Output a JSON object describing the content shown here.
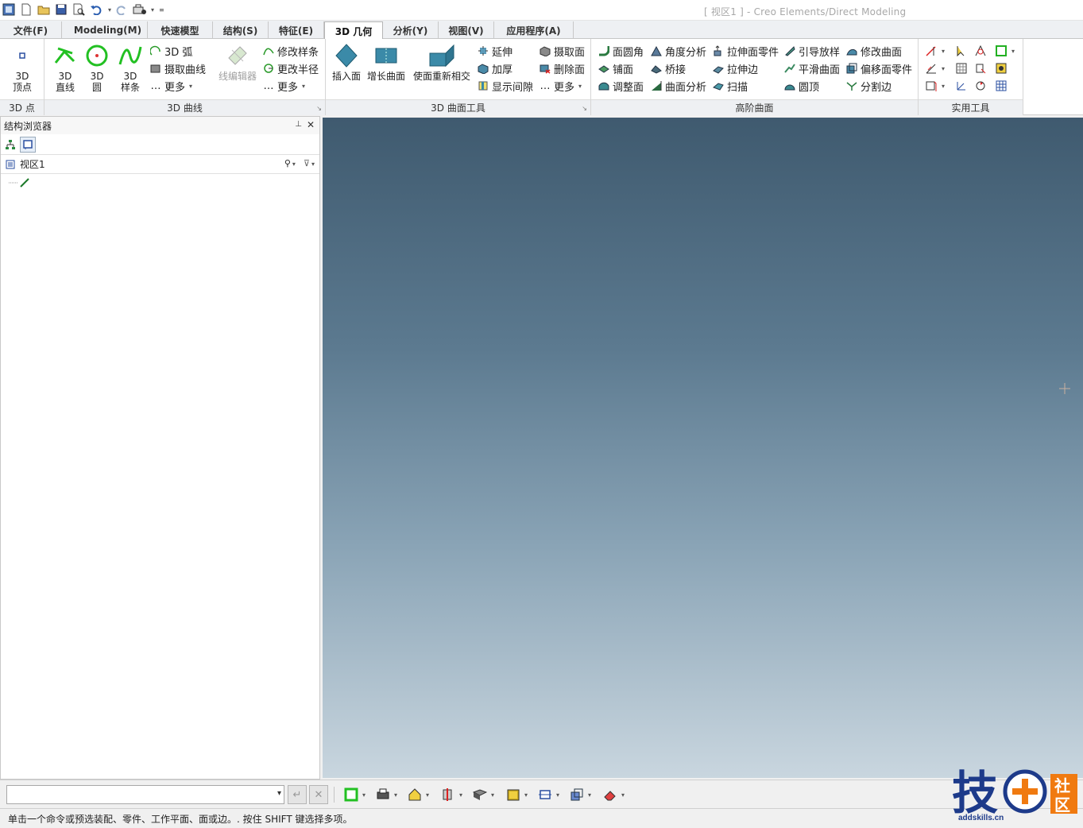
{
  "window": {
    "title": "[ 视区1 ] - Creo Elements/Direct Modeling"
  },
  "quick_access": {
    "icons": [
      "app-menu-icon",
      "new-file-icon",
      "open-folder-icon",
      "save-icon",
      "print-preview-icon",
      "undo-icon",
      "redo-icon",
      "settings-tool-icon",
      "customize-icon"
    ]
  },
  "tabs": [
    {
      "label": "文件(F)"
    },
    {
      "label": "Modeling(M)"
    },
    {
      "label": "快速模型"
    },
    {
      "label": "结构(S)"
    },
    {
      "label": "特征(E)"
    },
    {
      "label": "3D 几何",
      "active": true
    },
    {
      "label": "分析(Y)"
    },
    {
      "label": "视图(V)"
    },
    {
      "label": "应用程序(A)"
    }
  ],
  "ribbon": {
    "groups": {
      "point": {
        "label": "3D 点",
        "vertex": "3D\n顶点"
      },
      "curve": {
        "label": "3D 曲线",
        "line": "3D\n直线",
        "circle": "3D\n圆",
        "spline": "3D\n样条",
        "arc": "3D 弧",
        "extract_curve": "摄取曲线",
        "more1": "更多",
        "wire_editor": "线编辑器",
        "modify_spline": "修改样条",
        "change_radius": "更改半径",
        "more2": "更多"
      },
      "surface_tools": {
        "label": "3D 曲面工具",
        "insert_face": "插入面",
        "grow_surface": "增长曲面",
        "reintersect": "使面重新相交",
        "extend": "延伸",
        "thicken": "加厚",
        "show_gap": "显示间隙",
        "extract_face": "摄取面",
        "delete_face": "删除面",
        "more": "更多"
      },
      "advanced": {
        "label": "高阶曲面",
        "fillet": "面圆角",
        "pave": "铺面",
        "adjust": "调整面",
        "angle_analysis": "角度分析",
        "bridge": "桥接",
        "surface_analysis": "曲面分析",
        "extrude_part": "拉伸面零件",
        "extrude_edge": "拉伸边",
        "sweep": "扫描",
        "guided_loft": "引导放样",
        "smooth_surface": "平滑曲面",
        "dome": "圆顶",
        "modify_surface": "修改曲面",
        "offset_part": "偏移面零件",
        "split_edge": "分割边"
      },
      "utilities": {
        "label": "实用工具"
      }
    }
  },
  "structure_browser": {
    "title": "结构浏览器",
    "root_item": "视区1"
  },
  "command_line": {
    "value": ""
  },
  "status": {
    "message": "单击一个命令或预选装配、零件、工作平面、面或边。. 按住 SHIFT 键选择多项。"
  },
  "watermark": {
    "char1": "技",
    "char2": "社",
    "char3": "区",
    "url": "addskills.cn"
  },
  "colors": {
    "viewport_top": "#3f5a6f",
    "viewport_bottom": "#c9d6df",
    "accent_green": "#22c022"
  }
}
